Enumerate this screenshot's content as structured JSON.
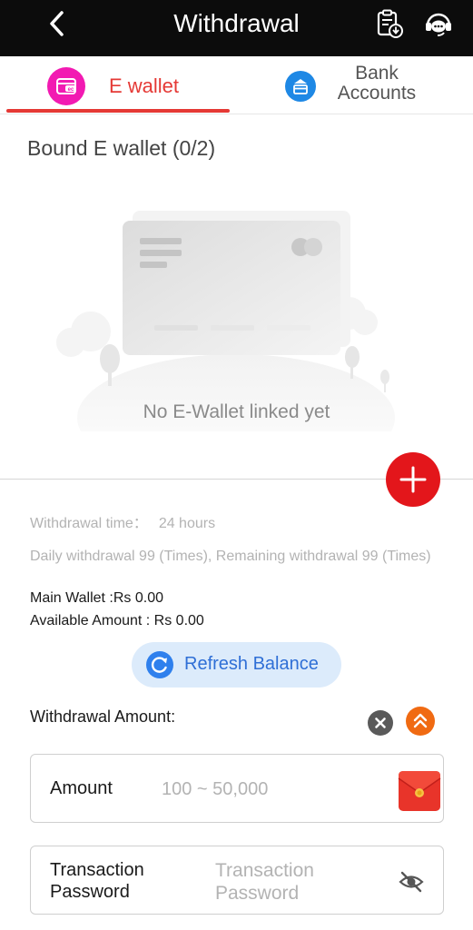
{
  "header": {
    "title": "Withdrawal",
    "back_icon": "chevron-left-icon",
    "records_icon": "clipboard-download-icon",
    "support_icon": "headset-chat-icon"
  },
  "tabs": [
    {
      "label": "E wallet",
      "icon": "wallet-icon",
      "active": true,
      "color": "#f21ab2"
    },
    {
      "label": "Bank Accounts",
      "icon": "bank-card-icon",
      "active": false,
      "color": "#1e88e5"
    }
  ],
  "bound": {
    "title": "Bound E wallet (0/2)",
    "empty_text": "No E-Wallet linked yet"
  },
  "add_button": {
    "icon": "plus-icon",
    "color": "#e3161b"
  },
  "info": {
    "withdrawal_time_label": "Withdrawal time：",
    "withdrawal_time_value": "24 hours",
    "daily_text": "Daily withdrawal 99 (Times), Remaining withdrawal 99 (Times)",
    "main_wallet": "Main Wallet :Rs 0.00",
    "available_amount": "Available Amount : Rs 0.00"
  },
  "refresh": {
    "label": "Refresh Balance",
    "icon": "refresh-icon"
  },
  "amount_section": {
    "label": "Withdrawal Amount:",
    "clear_icon": "close-circle-icon",
    "collapse_icon": "double-chevron-up-icon"
  },
  "amount_field": {
    "label": "Amount",
    "placeholder": "100 ~ 50,000",
    "envelope_icon": "red-envelope-icon"
  },
  "password_field": {
    "label": "Transaction Password",
    "placeholder": "Transaction Password",
    "eye_icon": "eye-off-icon"
  },
  "colors": {
    "accent_red": "#e53935",
    "refresh_blue": "#2f80ed",
    "header_bg": "#0c0c0c"
  }
}
